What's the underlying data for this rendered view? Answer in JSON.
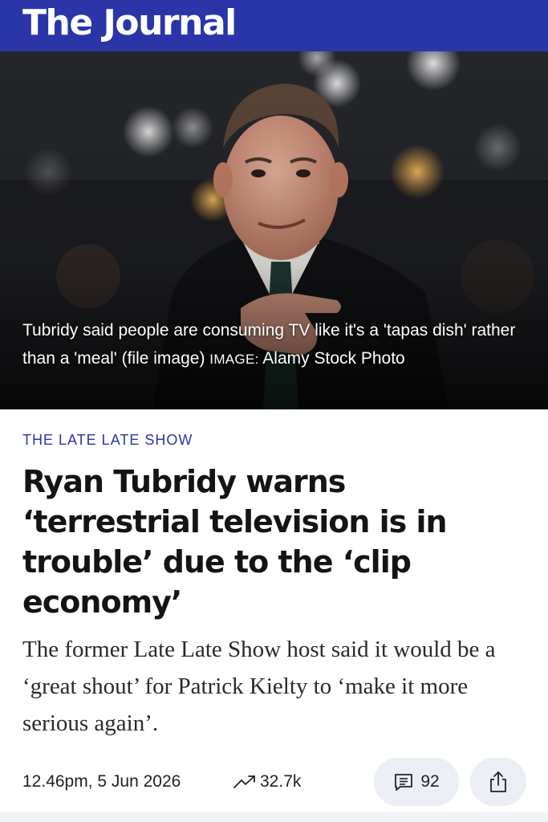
{
  "header": {
    "brand": "The Journal",
    "brand_color": "#2a35a8"
  },
  "hero": {
    "caption": "Tubridy said people are consuming TV like it's a 'tapas dish' rather than a 'meal' (file image)",
    "credit_label": "IMAGE:",
    "credit": "Alamy Stock Photo"
  },
  "article": {
    "section": "THE LATE LATE SHOW",
    "headline": "Ryan Tubridy warns ‘terrestrial television is in trouble’ due to the ‘clip economy’",
    "standfirst": "The former Late Late Show host said it would be a ‘great shout’ for Patrick Kielty to ‘make it more serious again’."
  },
  "meta": {
    "timestamp": "12.46pm, 5 Jun 2026",
    "trending_icon": "trending-up-icon",
    "trending_count": "32.7k",
    "comments_icon": "comment-icon",
    "comment_count": "92",
    "share_icon": "share-icon"
  }
}
